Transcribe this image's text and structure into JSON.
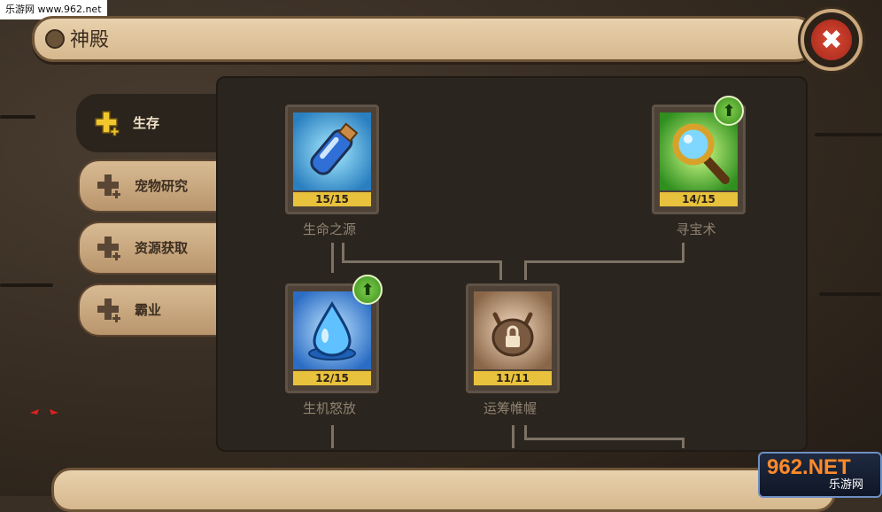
{
  "watermark_top": "乐游网 www.962.net",
  "title": "神殿",
  "tabs": [
    {
      "label": "生存",
      "active": true
    },
    {
      "label": "宠物研究",
      "active": false
    },
    {
      "label": "资源获取",
      "active": false
    },
    {
      "label": "霸业",
      "active": false
    }
  ],
  "skills": [
    {
      "name": "生命之源",
      "level": "15/15",
      "icon": "potion-bottle-icon",
      "upgrade": false
    },
    {
      "name": "寻宝术",
      "level": "14/15",
      "icon": "magnifier-icon",
      "upgrade": true
    },
    {
      "name": "生机怒放",
      "level": "12/15",
      "icon": "water-drop-icon",
      "upgrade": true
    },
    {
      "name": "运筹帷幄",
      "level": "11/11",
      "icon": "locked-demon-icon",
      "upgrade": false
    }
  ],
  "watermark_logo": {
    "main": "962.NET",
    "sub": "乐游网"
  },
  "colors": {
    "accent": "#e8c23c",
    "close": "#d84a33",
    "upgrade": "#5cb132",
    "panel": "#2b251f"
  }
}
